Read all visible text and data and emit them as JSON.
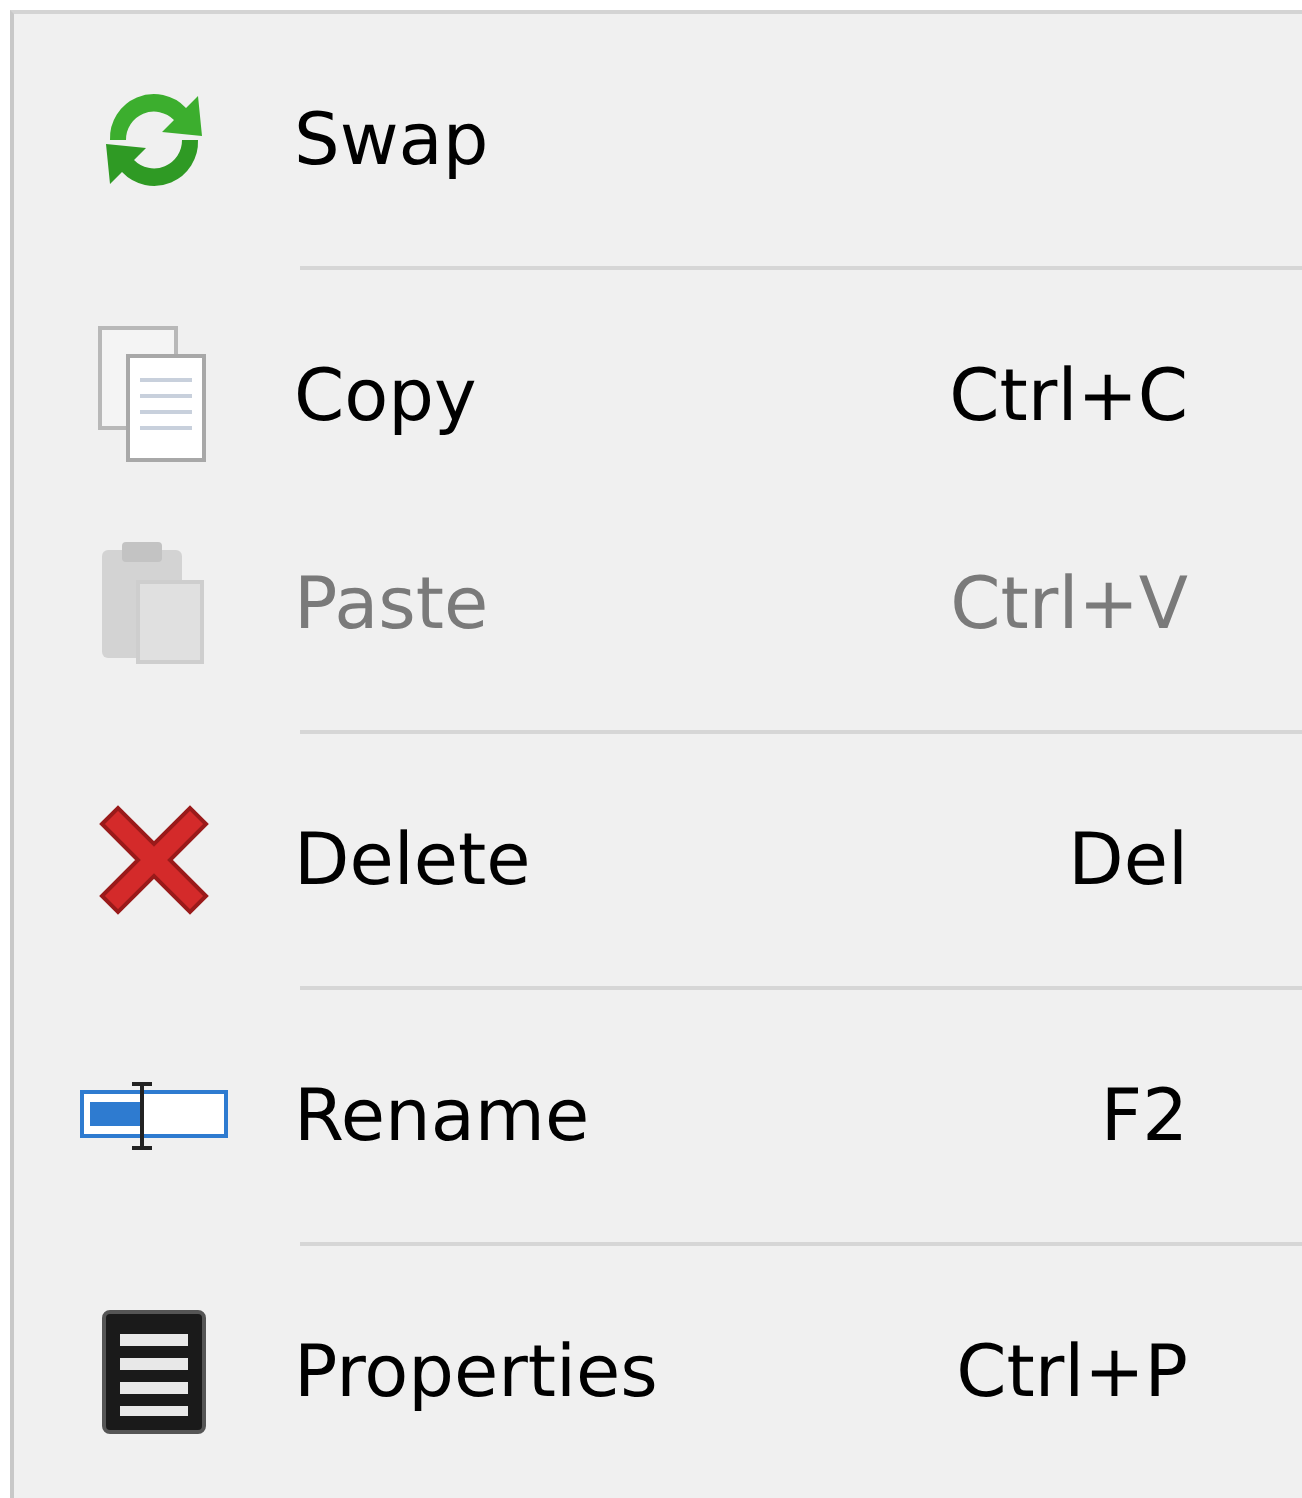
{
  "menu": {
    "items": [
      {
        "kind": "item",
        "label": "Swap",
        "disabled": false
      },
      {
        "kind": "separator"
      },
      {
        "kind": "item",
        "label": "Copy",
        "shortcut": "Ctrl+C",
        "disabled": false
      },
      {
        "kind": "item",
        "label": "Paste",
        "shortcut": "Ctrl+V",
        "disabled": true
      },
      {
        "kind": "separator"
      },
      {
        "kind": "item",
        "label": "Delete",
        "shortcut": "Del",
        "disabled": false
      },
      {
        "kind": "separator"
      },
      {
        "kind": "item",
        "label": "Rename",
        "shortcut": "F2",
        "disabled": false
      },
      {
        "kind": "separator"
      },
      {
        "kind": "item",
        "label": "Properties",
        "shortcut": "Ctrl+P",
        "disabled": false
      }
    ]
  }
}
